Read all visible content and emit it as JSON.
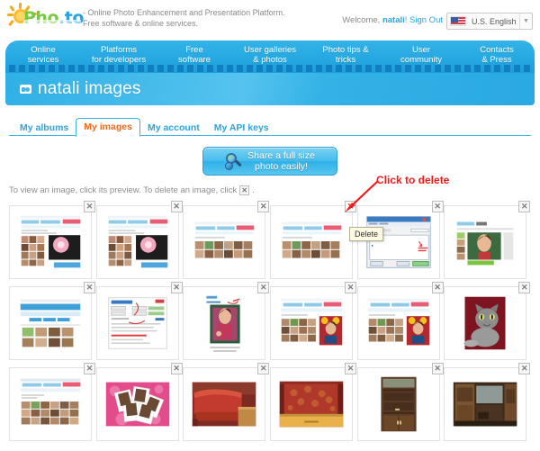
{
  "header": {
    "logo_text_a": "Pho",
    "logo_text_b": ".to",
    "tagline_line1": "- Online Photo Enhancement and Presentation Platform.",
    "tagline_line2": "Free software & online services.",
    "welcome_prefix": "Welcome,",
    "user_name": "natali",
    "welcome_suffix": "!",
    "sign_out": "Sign Out",
    "language": "U.S. English"
  },
  "nav": {
    "items": [
      {
        "line1": "Online",
        "line2": "services"
      },
      {
        "line1": "Platforms",
        "line2": "for developers"
      },
      {
        "line1": "Free",
        "line2": "software"
      },
      {
        "line1": "User galleries",
        "line2": "& photos"
      },
      {
        "line1": "Photo tips &",
        "line2": "tricks"
      },
      {
        "line1": "User",
        "line2": "community"
      },
      {
        "line1": "Contacts",
        "line2": "& Press"
      }
    ]
  },
  "page": {
    "title": "natali images"
  },
  "tabs": [
    {
      "label": "My albums",
      "active": false
    },
    {
      "label": "My images",
      "active": true
    },
    {
      "label": "My account",
      "active": false
    },
    {
      "label": "My API keys",
      "active": false
    }
  ],
  "share_button": {
    "line1": "Share a full size",
    "line2": "photo easily!"
  },
  "instructions": {
    "text_before": "To view an image, click its preview. To delete an image, click",
    "icon_glyph": "✕",
    "text_after": "."
  },
  "annotation": {
    "text": "Click to delete",
    "color": "#f31a1a"
  },
  "tooltip": {
    "label": "Delete"
  },
  "grid": {
    "close_glyph": "✕",
    "items": [
      {
        "id": 1,
        "kind": "webpage-gallery-pink",
        "highlight": false
      },
      {
        "id": 2,
        "kind": "webpage-gallery-pink",
        "highlight": false
      },
      {
        "id": 3,
        "kind": "webpage-facecrowd",
        "highlight": false
      },
      {
        "id": 4,
        "kind": "webpage-facecrowd",
        "highlight": true
      },
      {
        "id": 5,
        "kind": "desktop-dialog",
        "highlight": false
      },
      {
        "id": 6,
        "kind": "webpage-girl-portrait",
        "highlight": false
      },
      {
        "id": 7,
        "kind": "webpage-bluebanner",
        "highlight": false
      },
      {
        "id": 8,
        "kind": "document-redmark",
        "highlight": false
      },
      {
        "id": 9,
        "kind": "photo-woman-pink",
        "highlight": false
      },
      {
        "id": 10,
        "kind": "webpage-man-flowers",
        "highlight": false
      },
      {
        "id": 11,
        "kind": "webpage-man-flowers",
        "highlight": false
      },
      {
        "id": 12,
        "kind": "photo-cat-red",
        "highlight": false
      },
      {
        "id": 13,
        "kind": "webpage-facegrid",
        "highlight": false
      },
      {
        "id": 14,
        "kind": "photo-polaroids-pink",
        "highlight": false
      },
      {
        "id": 15,
        "kind": "photo-sofa-red",
        "highlight": false
      },
      {
        "id": 16,
        "kind": "photo-room-red",
        "highlight": false
      },
      {
        "id": 17,
        "kind": "photo-cabinet",
        "highlight": false
      },
      {
        "id": 18,
        "kind": "photo-wallunit",
        "highlight": false
      }
    ]
  }
}
